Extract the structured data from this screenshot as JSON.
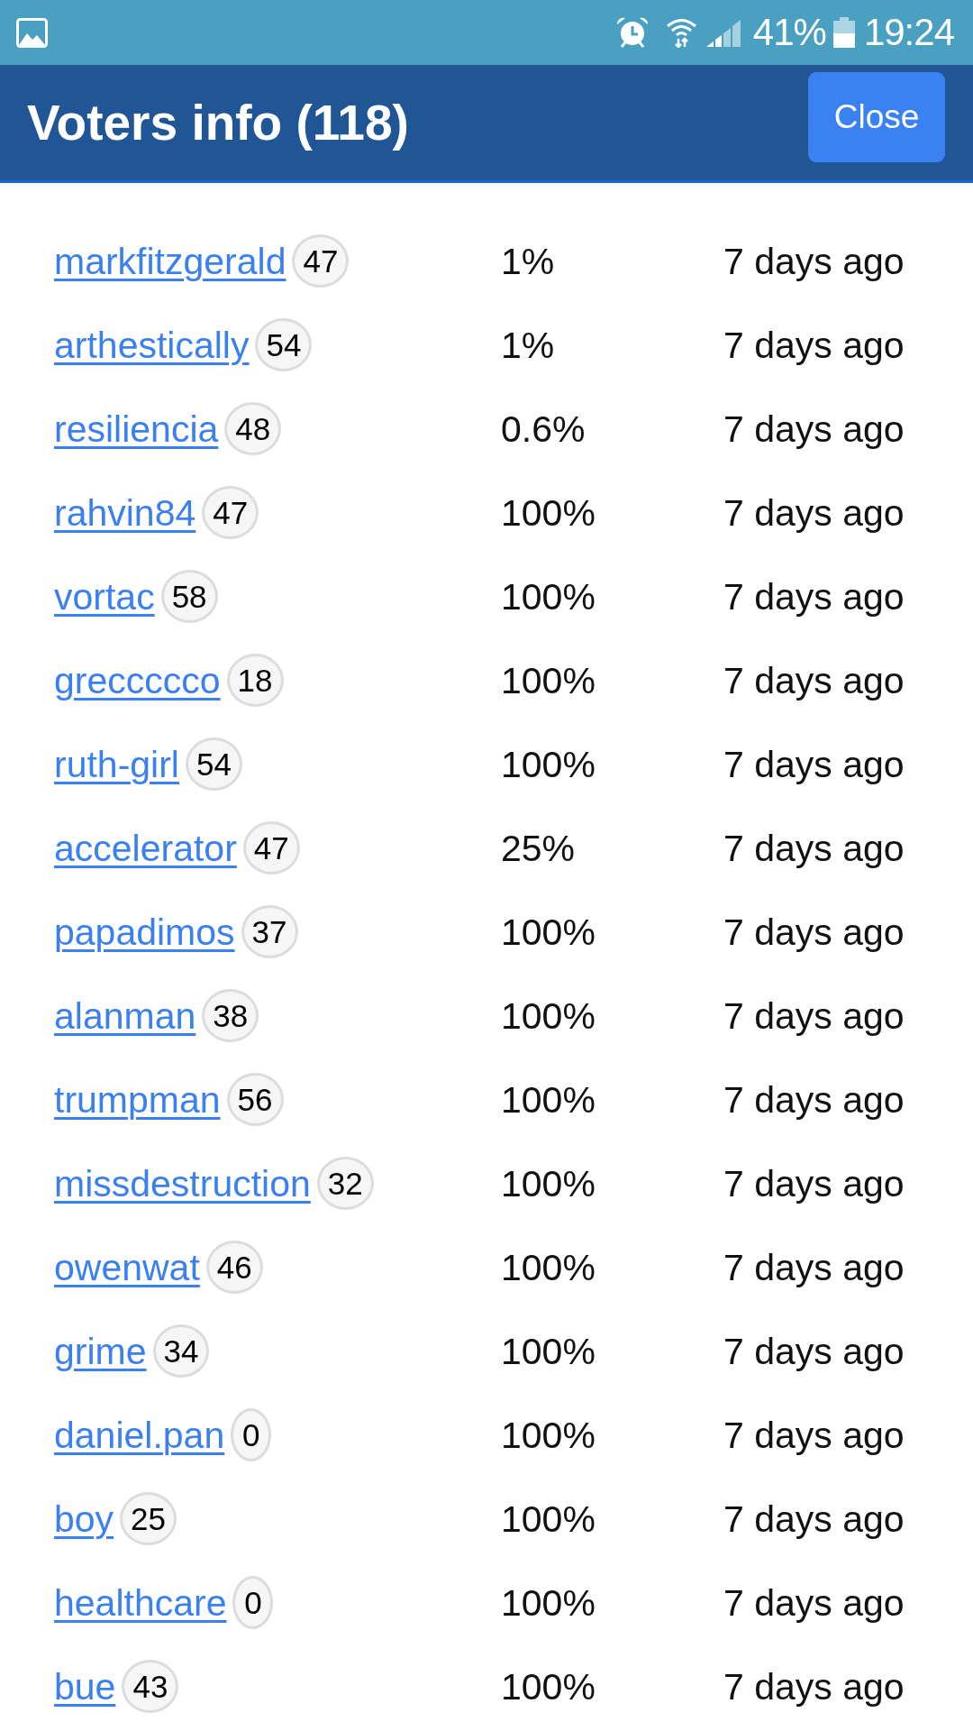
{
  "status_bar": {
    "battery": "41%",
    "time": "19:24"
  },
  "header": {
    "title": "Voters info (118)",
    "close_button": "Close"
  },
  "voters": [
    {
      "name": "markfitzgerald",
      "reputation": "47",
      "weight": "1%",
      "time": "7 days ago"
    },
    {
      "name": "arthestically",
      "reputation": "54",
      "weight": "1%",
      "time": "7 days ago"
    },
    {
      "name": "resiliencia",
      "reputation": "48",
      "weight": "0.6%",
      "time": "7 days ago"
    },
    {
      "name": "rahvin84",
      "reputation": "47",
      "weight": "100%",
      "time": "7 days ago"
    },
    {
      "name": "vortac",
      "reputation": "58",
      "weight": "100%",
      "time": "7 days ago"
    },
    {
      "name": "greccccco",
      "reputation": "18",
      "weight": "100%",
      "time": "7 days ago"
    },
    {
      "name": "ruth-girl",
      "reputation": "54",
      "weight": "100%",
      "time": "7 days ago"
    },
    {
      "name": "accelerator",
      "reputation": "47",
      "weight": "25%",
      "time": "7 days ago"
    },
    {
      "name": "papadimos",
      "reputation": "37",
      "weight": "100%",
      "time": "7 days ago"
    },
    {
      "name": "alanman",
      "reputation": "38",
      "weight": "100%",
      "time": "7 days ago"
    },
    {
      "name": "trumpman",
      "reputation": "56",
      "weight": "100%",
      "time": "7 days ago"
    },
    {
      "name": "missdestruction",
      "reputation": "32",
      "weight": "100%",
      "time": "7 days ago"
    },
    {
      "name": "owenwat",
      "reputation": "46",
      "weight": "100%",
      "time": "7 days ago"
    },
    {
      "name": "grime",
      "reputation": "34",
      "weight": "100%",
      "time": "7 days ago"
    },
    {
      "name": "daniel.pan",
      "reputation": "0",
      "weight": "100%",
      "time": "7 days ago"
    },
    {
      "name": "boy",
      "reputation": "25",
      "weight": "100%",
      "time": "7 days ago"
    },
    {
      "name": "healthcare",
      "reputation": "0",
      "weight": "100%",
      "time": "7 days ago"
    },
    {
      "name": "bue",
      "reputation": "43",
      "weight": "100%",
      "time": "7 days ago"
    }
  ]
}
